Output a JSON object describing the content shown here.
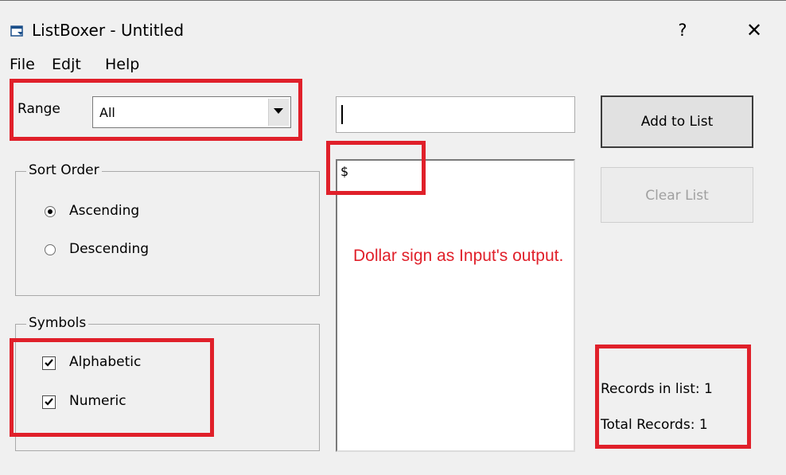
{
  "window": {
    "title": "ListBoxer - Untitled",
    "help_glyph": "?",
    "close_glyph": "✕",
    "icon": "app-window-icon"
  },
  "menu": {
    "file": "File",
    "edit": "Edjt",
    "help": "Help"
  },
  "range": {
    "label": "Range",
    "selected": "All",
    "arrow_icon": "chevron-down-icon"
  },
  "sort_order": {
    "title": "Sort Order",
    "options": [
      {
        "label": "Ascending",
        "checked": true
      },
      {
        "label": "Descending",
        "checked": false
      }
    ]
  },
  "symbols": {
    "title": "Symbols",
    "options": [
      {
        "label": "Alphabetic",
        "checked": true
      },
      {
        "label": "Numeric",
        "checked": true
      }
    ]
  },
  "input": {
    "value": ""
  },
  "list": {
    "items": [
      "$"
    ]
  },
  "buttons": {
    "add": "Add to List",
    "clear": "Clear List"
  },
  "stats": {
    "records_in_list": "Records in list: 1",
    "total_records": "Total Records: 1"
  },
  "annotation": {
    "text": "Dollar sign as Input's output.",
    "color": "#e0202a"
  }
}
